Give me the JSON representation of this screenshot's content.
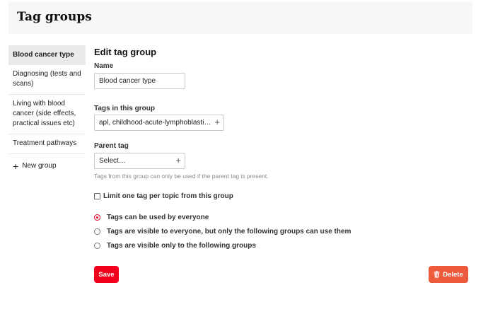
{
  "page": {
    "title": "Tag groups"
  },
  "sidebar": {
    "items": [
      {
        "label": "Blood cancer type"
      },
      {
        "label": "Diagnosing (tests and scans)"
      },
      {
        "label": "Living with blood cancer (side effects, practical issues etc)"
      },
      {
        "label": "Treatment pathways"
      }
    ],
    "new_group_label": "New group"
  },
  "form": {
    "heading": "Edit tag group",
    "name_label": "Name",
    "name_value": "Blood cancer type",
    "tags_label": "Tags in this group",
    "tags_value": "apl, childhood-acute-lymphoblasti…",
    "parent_label": "Parent tag",
    "parent_value": "Select…",
    "parent_hint": "Tags from this group can only be used if the parent tag is present.",
    "limit_label": "Limit one tag per topic from this group",
    "visibility_options": [
      {
        "label": "Tags can be used by everyone"
      },
      {
        "label": "Tags are visible to everyone, but only the following groups can use them"
      },
      {
        "label": "Tags are visible only to the following groups"
      }
    ],
    "save_label": "Save",
    "delete_label": "Delete"
  },
  "colors": {
    "accent": "#f0001a",
    "delete": "#ee5a3c"
  },
  "icons": {
    "plus": "plus-icon",
    "trash": "trash-icon"
  }
}
